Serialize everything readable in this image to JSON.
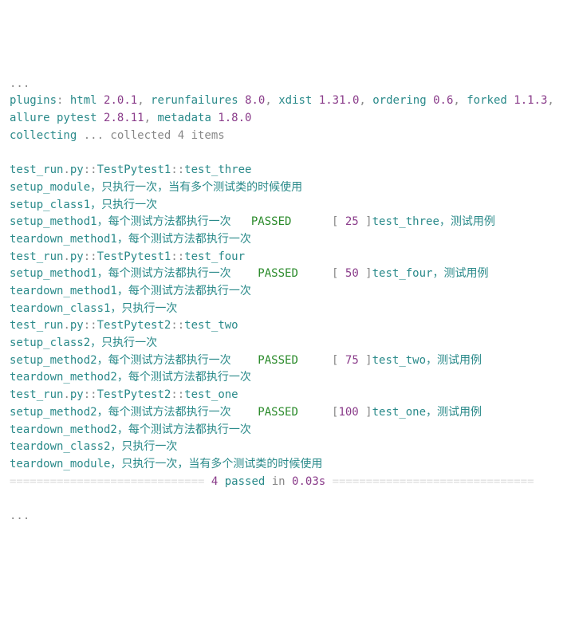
{
  "ellipsis": "...",
  "header": {
    "plugins_label": "plugins",
    "colon": ": ",
    "html": "html ",
    "html_v": "2.0.1",
    "sep": ", ",
    "rerun": "rerunfailures ",
    "rerun_v": "8.0",
    "xdist": "xdist ",
    "xdist_v": "1.31.0",
    "ordering": "ordering ",
    "ordering_v": "0.6",
    "forked": "forked ",
    "forked_v": "1.1.3",
    "allure": "allure pytest ",
    "allure_v": "2.8.11",
    "metadata": "metadata ",
    "metadata_v": "1.8.0",
    "collecting": "collecting ",
    "coll_rest": "... collected 4 items"
  },
  "tests": [
    {
      "file": "test_run",
      "dot": ".",
      "ext": "py",
      "sep": "::",
      "cls": "TestPytest1",
      "name": "test_three",
      "module_setup": "setup_module，只执行一次，当有多个测试类的时候使用",
      "class_setup": "setup_class1，只执行一次",
      "method_setup": "setup_method1，每个测试方法都执行一次   ",
      "passed": "PASSED",
      "pct_open": "      [ ",
      "pct": "25",
      "pct_close": " ]",
      "trail": "test_three，测试用例",
      "method_td": "teardown_method1，每个测试方法都执行一次",
      "class_td": null,
      "module_td": null
    },
    {
      "file": "test_run",
      "dot": ".",
      "ext": "py",
      "sep": "::",
      "cls": "TestPytest1",
      "name": "test_four",
      "module_setup": null,
      "class_setup": null,
      "method_setup": "setup_method1，每个测试方法都执行一次    ",
      "passed": "PASSED",
      "pct_open": "     [ ",
      "pct": "50",
      "pct_close": " ]",
      "trail": "test_four，测试用例",
      "method_td": "teardown_method1，每个测试方法都执行一次",
      "class_td": "teardown_class1，只执行一次",
      "module_td": null
    },
    {
      "file": "test_run",
      "dot": ".",
      "ext": "py",
      "sep": "::",
      "cls": "TestPytest2",
      "name": "test_two",
      "module_setup": null,
      "class_setup": "setup_class2，只执行一次",
      "method_setup": "setup_method2，每个测试方法都执行一次    ",
      "passed": "PASSED",
      "pct_open": "     [ ",
      "pct": "75",
      "pct_close": " ]",
      "trail": "test_two，测试用例",
      "method_td": "teardown_method2，每个测试方法都执行一次",
      "class_td": null,
      "module_td": null
    },
    {
      "file": "test_run",
      "dot": ".",
      "ext": "py",
      "sep": "::",
      "cls": "TestPytest2",
      "name": "test_one",
      "module_setup": null,
      "class_setup": null,
      "method_setup": "setup_method2，每个测试方法都执行一次    ",
      "passed": "PASSED",
      "pct_open": "     [",
      "pct": "100",
      "pct_close": " ]",
      "trail": "test_one，测试用例",
      "method_td": "teardown_method2，每个测试方法都执行一次",
      "class_td": "teardown_class2，只执行一次",
      "module_td": "teardown_module，只执行一次，当有多个测试类的时候使用"
    }
  ],
  "summary": {
    "rule_pre": "============================= ",
    "count": "4",
    "passed": " passed ",
    "in": "in ",
    "time": "0.03s",
    "rule_post": " =============================="
  }
}
